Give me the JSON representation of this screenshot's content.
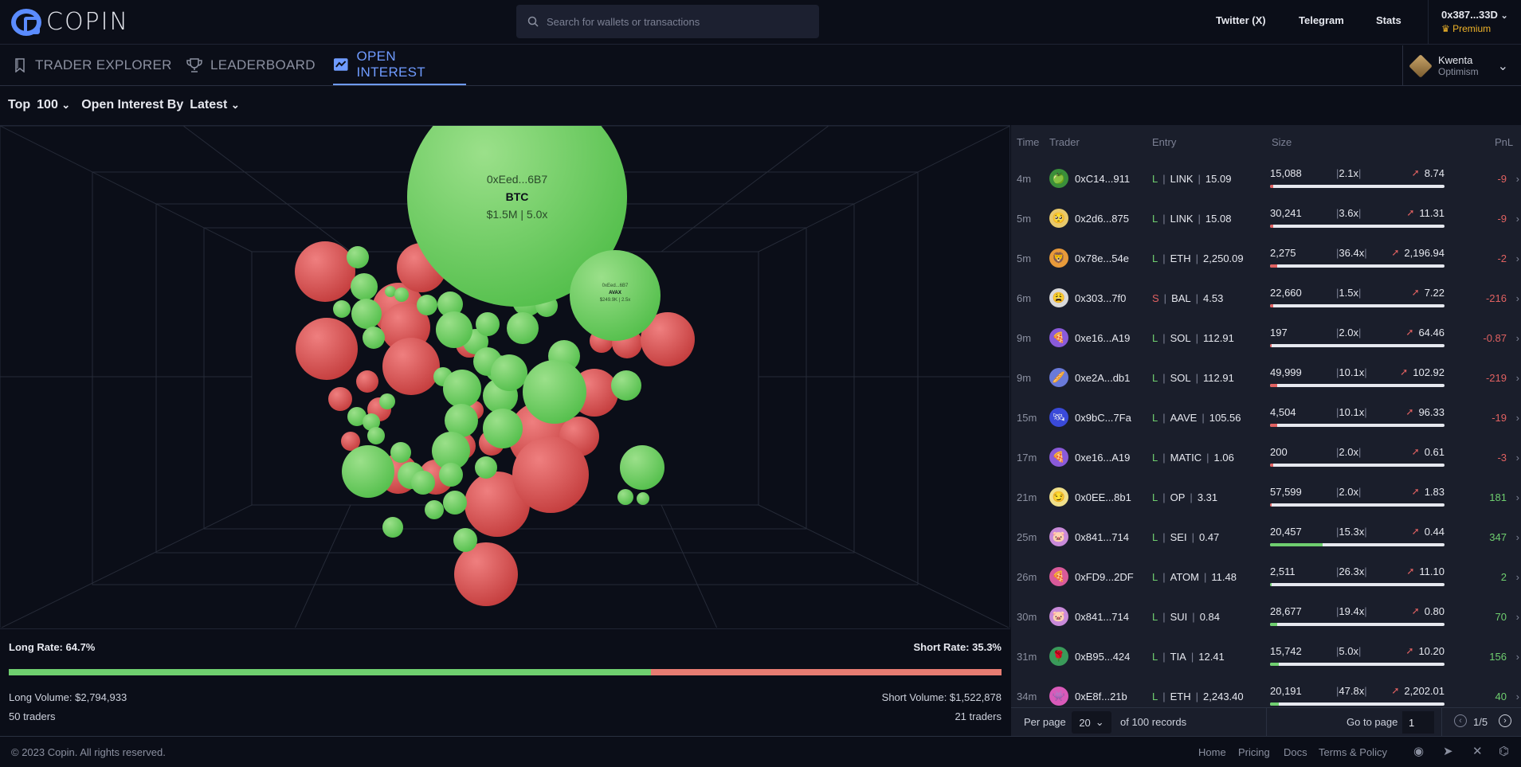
{
  "app": {
    "logo_text": "COPIN"
  },
  "search": {
    "placeholder": "Search for wallets or transactions"
  },
  "topnav": {
    "twitter": "Twitter (X)",
    "telegram": "Telegram",
    "stats": "Stats"
  },
  "wallet": {
    "address": "0x387...33D",
    "tier": "Premium"
  },
  "tabs": [
    {
      "label": "TRADER EXPLORER",
      "icon": "bookmark-icon"
    },
    {
      "label": "LEADERBOARD",
      "icon": "trophy-icon"
    },
    {
      "label": "OPEN INTEREST",
      "icon": "chart-icon",
      "active": true
    }
  ],
  "protocol": {
    "name": "Kwenta",
    "network": "Optimism"
  },
  "filters": {
    "top_label": "Top",
    "top_value": "100",
    "by_label": "Open Interest By",
    "by_value": "Latest"
  },
  "bubbles": {
    "btc": {
      "trader": "0xEed...6B7",
      "token": "BTC",
      "value": "$1.5M | 5.0x"
    },
    "avax": {
      "trader": "0xEed...6B7",
      "token": "AVAX",
      "value": "$249.9K | 2.5x"
    }
  },
  "rates": {
    "long_rate": "Long Rate: 64.7%",
    "short_rate": "Short Rate: 35.3%",
    "long_fraction": 0.647,
    "long_volume": "Long Volume: $2,794,933",
    "short_volume": "Short Volume: $1,522,878",
    "long_traders": "50 traders",
    "short_traders": "21 traders"
  },
  "table": {
    "headers": {
      "time": "Time",
      "trader": "Trader",
      "entry": "Entry",
      "size": "Size",
      "pnl": "PnL"
    },
    "rows": [
      {
        "time": "4m",
        "trader": "0xC14...911",
        "side": "L",
        "token": "LINK",
        "price": "15.09",
        "size": "15,088",
        "lev": "2.1x",
        "liq": "8.74",
        "pnl": "-9",
        "avatar": "🍏",
        "avbg": "#3a8f3a",
        "fill": 0.02,
        "fillc": "#e06161"
      },
      {
        "time": "5m",
        "trader": "0x2d6...875",
        "side": "L",
        "token": "LINK",
        "price": "15.08",
        "size": "30,241",
        "lev": "3.6x",
        "liq": "11.31",
        "pnl": "-9",
        "avatar": "🥺",
        "avbg": "#e8c96a",
        "fill": 0.02,
        "fillc": "#e06161"
      },
      {
        "time": "5m",
        "trader": "0x78e...54e",
        "side": "L",
        "token": "ETH",
        "price": "2,250.09",
        "size": "2,275",
        "lev": "36.4x",
        "liq": "2,196.94",
        "pnl": "-2",
        "avatar": "🦁",
        "avbg": "#e89a3a",
        "fill": 0.04,
        "fillc": "#e06161"
      },
      {
        "time": "6m",
        "trader": "0x303...7f0",
        "side": "S",
        "token": "BAL",
        "price": "4.53",
        "size": "22,660",
        "lev": "1.5x",
        "liq": "7.22",
        "pnl": "-216",
        "avatar": "😩",
        "avbg": "#d9d9d9",
        "fill": 0.02,
        "fillc": "#e06161"
      },
      {
        "time": "9m",
        "trader": "0xe16...A19",
        "side": "L",
        "token": "SOL",
        "price": "112.91",
        "size": "197",
        "lev": "2.0x",
        "liq": "64.46",
        "pnl": "-0.87",
        "avatar": "🍕",
        "avbg": "#8a5ad9",
        "fill": 0.01,
        "fillc": "#e06161"
      },
      {
        "time": "9m",
        "trader": "0xe2A...db1",
        "side": "L",
        "token": "SOL",
        "price": "112.91",
        "size": "49,999",
        "lev": "10.1x",
        "liq": "102.92",
        "pnl": "-219",
        "avatar": "🥖",
        "avbg": "#6a7ad9",
        "fill": 0.04,
        "fillc": "#e06161"
      },
      {
        "time": "15m",
        "trader": "0x9bC...7Fa",
        "side": "L",
        "token": "AAVE",
        "price": "105.56",
        "size": "4,504",
        "lev": "10.1x",
        "liq": "96.33",
        "pnl": "-19",
        "avatar": "🛰",
        "avbg": "#3a4ad9",
        "fill": 0.04,
        "fillc": "#e06161"
      },
      {
        "time": "17m",
        "trader": "0xe16...A19",
        "side": "L",
        "token": "MATIC",
        "price": "1.06",
        "size": "200",
        "lev": "2.0x",
        "liq": "0.61",
        "pnl": "-3",
        "avatar": "🍕",
        "avbg": "#8a5ad9",
        "fill": 0.02,
        "fillc": "#e06161"
      },
      {
        "time": "21m",
        "trader": "0x0EE...8b1",
        "side": "L",
        "token": "OP",
        "price": "3.31",
        "size": "57,599",
        "lev": "2.0x",
        "liq": "1.83",
        "pnl": "181",
        "avatar": "😏",
        "avbg": "#f0e08a",
        "fill": 0.01,
        "fillc": "#e06161"
      },
      {
        "time": "25m",
        "trader": "0x841...714",
        "side": "L",
        "token": "SEI",
        "price": "0.47",
        "size": "20,457",
        "lev": "15.3x",
        "liq": "0.44",
        "pnl": "347",
        "avatar": "🐷",
        "avbg": "#c98ad9",
        "fill": 0.3,
        "fillc": "#6fcf6f"
      },
      {
        "time": "26m",
        "trader": "0xFD9...2DF",
        "side": "L",
        "token": "ATOM",
        "price": "11.48",
        "size": "2,511",
        "lev": "26.3x",
        "liq": "11.10",
        "pnl": "2",
        "avatar": "🍕",
        "avbg": "#d95a9a",
        "fill": 0.01,
        "fillc": "#6fcf6f"
      },
      {
        "time": "30m",
        "trader": "0x841...714",
        "side": "L",
        "token": "SUI",
        "price": "0.84",
        "size": "28,677",
        "lev": "19.4x",
        "liq": "0.80",
        "pnl": "70",
        "avatar": "🐷",
        "avbg": "#c98ad9",
        "fill": 0.04,
        "fillc": "#6fcf6f"
      },
      {
        "time": "31m",
        "trader": "0xB95...424",
        "side": "L",
        "token": "TIA",
        "price": "12.41",
        "size": "15,742",
        "lev": "5.0x",
        "liq": "10.20",
        "pnl": "156",
        "avatar": "🌹",
        "avbg": "#3a9a5a",
        "fill": 0.05,
        "fillc": "#6fcf6f"
      },
      {
        "time": "34m",
        "trader": "0xE8f...21b",
        "side": "L",
        "token": "ETH",
        "price": "2,243.40",
        "size": "20,191",
        "lev": "47.8x",
        "liq": "2,202.01",
        "pnl": "40",
        "avatar": "👾",
        "avbg": "#d95ab9",
        "fill": 0.05,
        "fillc": "#6fcf6f"
      }
    ]
  },
  "pager": {
    "per_page_label": "Per page",
    "per_page_value": "20",
    "records": "of 100 records",
    "goto_label": "Go to page",
    "goto_value": "1",
    "page_indicator": "1/5"
  },
  "footer": {
    "copyright": "© 2023 Copin. All rights reserved.",
    "links": [
      "Home",
      "Pricing",
      "Docs",
      "Terms & Policy"
    ]
  },
  "colors": {
    "long": "#6fcf6f",
    "short": "#e06161",
    "accent": "#6f9bff",
    "premium": "#f0b429"
  }
}
